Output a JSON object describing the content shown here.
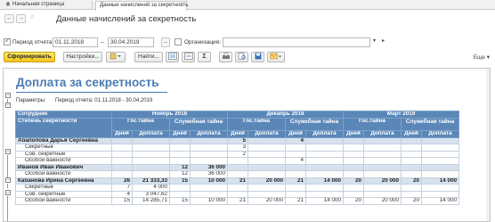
{
  "tabs": [
    {
      "label": "Начальная страница"
    },
    {
      "label": "Данные начислений за секретность"
    }
  ],
  "header": {
    "back": "←",
    "forward": "→",
    "star": "☆",
    "title": "Данные начислений за секретность"
  },
  "period": {
    "checked": true,
    "label": "Период отчета:",
    "from": "01.11.2018",
    "dash": "–",
    "to": "30.04.2019",
    "pick": "...",
    "org_label": "Организация:",
    "org_value": "",
    "org_dd": "▾",
    "org_open": "▸"
  },
  "toolbar": {
    "generate": "Сформировать",
    "settings": "Настройки...",
    "find": "Найти...",
    "sum": "Σ",
    "more": "Еще ▾"
  },
  "report": {
    "title": "Доплата за секретность",
    "params_label": "Параметры:",
    "params_value": "Период отчета: 01.11.2018 - 30.04.2019",
    "head": {
      "employee": "Сотрудник",
      "level": "Степень секретности",
      "months": [
        "Ноябрь 2018",
        "Декабрь 2018",
        "Март 2019"
      ],
      "gos": "Гос.тайна",
      "service": "Служебная тайна",
      "days": "Дней",
      "pay": "Доплата"
    },
    "rows": [
      {
        "kind": "emp",
        "cells": [
          "Абапопова Дарья Сергеевна",
          "",
          "",
          "",
          "",
          "5",
          "",
          "4",
          "",
          "",
          "",
          "",
          ""
        ]
      },
      {
        "kind": "sub",
        "cells": [
          "Секретные",
          "",
          "",
          "",
          "",
          "3",
          "",
          "",
          "",
          "",
          "",
          "",
          ""
        ]
      },
      {
        "kind": "sub",
        "cells": [
          "Сов. секретные",
          "",
          "",
          "",
          "",
          "2",
          "",
          "",
          "",
          "",
          "",
          "",
          ""
        ]
      },
      {
        "kind": "sub",
        "cells": [
          "Особой важности",
          "",
          "",
          "",
          "",
          "",
          "",
          "4",
          "",
          "",
          "",
          "",
          ""
        ]
      },
      {
        "kind": "emp",
        "cells": [
          "Иванов Иван Иванович",
          "",
          "",
          "12",
          "36 000",
          "",
          "",
          "",
          "",
          "",
          "",
          "",
          ""
        ]
      },
      {
        "kind": "sub",
        "cells": [
          "Особой важности",
          "",
          "",
          "12",
          "36 000",
          "",
          "",
          "",
          "",
          "",
          "",
          "",
          ""
        ]
      },
      {
        "kind": "emp",
        "cells": [
          "Кабанова Ирина Сергеевна",
          "26",
          "21 333,33",
          "15",
          "10 000",
          "21",
          "20 000",
          "21",
          "14 000",
          "20",
          "20 000",
          "20",
          "14 000"
        ]
      },
      {
        "kind": "sub",
        "cells": [
          "Секретные",
          "7",
          "4 000",
          "",
          "",
          "",
          "",
          "",
          "",
          "",
          "",
          "",
          ""
        ]
      },
      {
        "kind": "sub",
        "cells": [
          "Сов. секретные",
          "4",
          "3 047,62",
          "",
          "",
          "",
          "",
          "",
          "",
          "",
          "",
          "",
          ""
        ]
      },
      {
        "kind": "sub",
        "cells": [
          "Особой важности",
          "15",
          "14 285,71",
          "15",
          "10 000",
          "21",
          "20 000",
          "21",
          "14 000",
          "20",
          "20 000",
          "20",
          "14 000"
        ]
      }
    ]
  },
  "colors": {
    "accent": "#5a87b7",
    "title": "#4b7cb3",
    "primary": "#f3c51a",
    "row": "#d6e2ee"
  }
}
